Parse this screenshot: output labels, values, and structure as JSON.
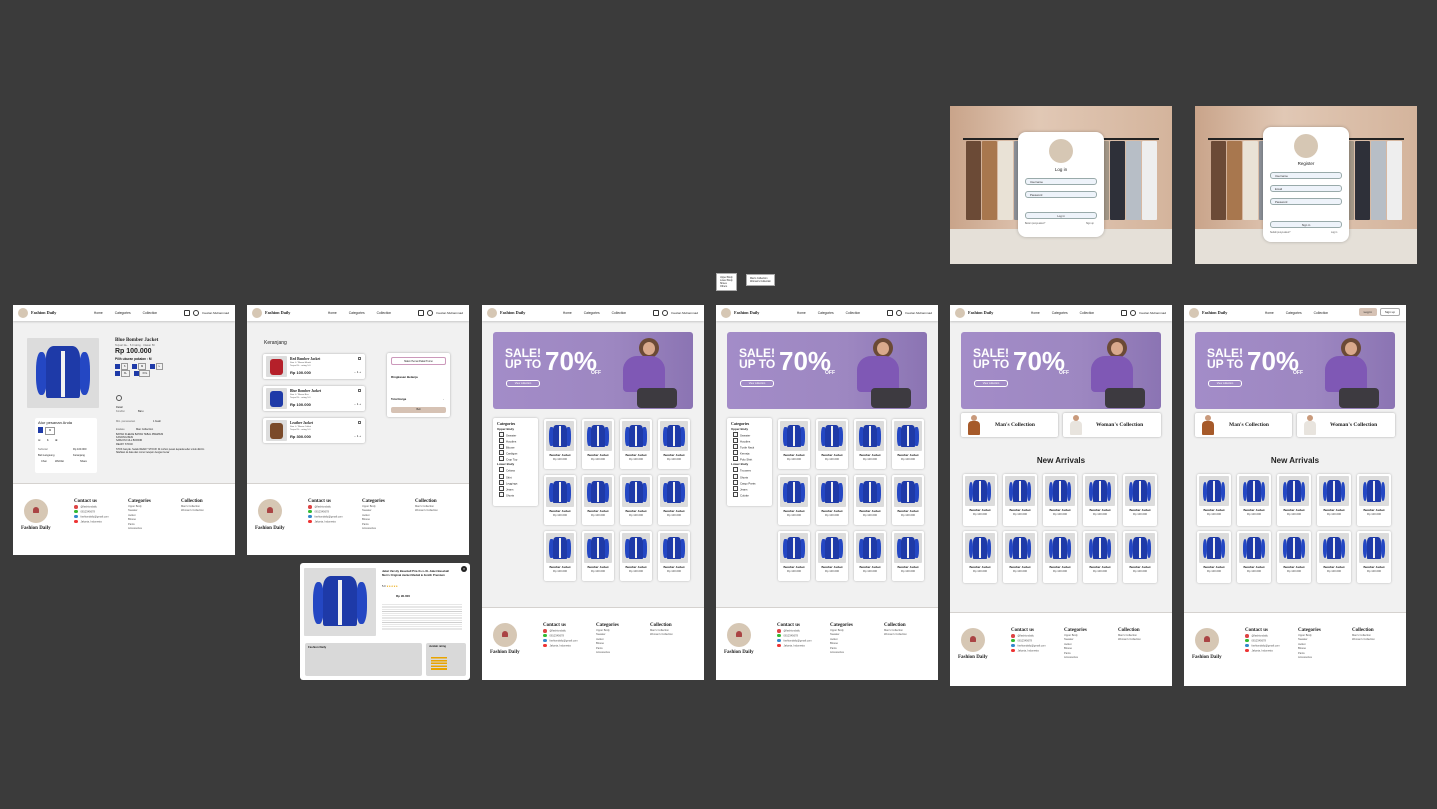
{
  "brand": "Fashion Daily",
  "nav": {
    "home": "Home",
    "categories": "Categories",
    "collection": "Collection",
    "user": "Fauzan Muhammad",
    "login": "Log in",
    "signup": "Sign up"
  },
  "banner": {
    "sale": "SALE!",
    "upto": "UP TO",
    "pct": "70%",
    "off": "OFF",
    "btn": "View collection"
  },
  "detail": {
    "title": "Blue Bomber Jacket",
    "sub": "Terjual 1k+ · 5.0 rating · Ulasan 50",
    "price": "Rp 100.000",
    "color_label": "Pilih ukuran pakaian : M",
    "sizes": [
      "S",
      "M",
      "L",
      "XL",
      "XXL"
    ],
    "order_title": "Atur pesanan Anda",
    "qty": "1",
    "subtotal_label": "Subtotal",
    "subtotal": "Rp 100.000",
    "buy": "Beli Langsung",
    "cart": "Keranjang",
    "chat": "Chat",
    "wishlist": "Wishlist",
    "share": "Share",
    "detail_tab": "Detail",
    "kondisi_label": "Kondisi",
    "kondisi": "Baru",
    "min_label": "Min. pemesanan",
    "min": "1 buah",
    "etalase_label": "Etalase",
    "etalase": "Man Collection",
    "desc1": "BAHAN FLEECE BAHAN TEBAL PREMIUM",
    "desc2": "KANCING BESI",
    "desc3": "SABLON FULL BORDIR",
    "desc4": "READY STOCK",
    "desc5": "STOK banyak. Selalu READY STOCK! Di mohon pesan kepada seller untuk dikirim",
    "desc6": "Silahkan isi data dan nomor telepon dengan benar"
  },
  "cart": {
    "title": "Keranjang",
    "items": [
      {
        "name": "Red Bomber Jacket",
        "d1": "Size L / Warna Merah",
        "d2": "Terjual 1k · rating 5.0",
        "price": "Rp 100.000",
        "qty": "1"
      },
      {
        "name": "Blue Bomber Jacket",
        "d1": "Size L / Warna Biru",
        "d2": "Terjual 1k · rating 5.0",
        "price": "Rp 100.000",
        "qty": "1"
      },
      {
        "name": "Leather Jacket",
        "d1": "Size L / Warna Coklat",
        "d2": "Terjual 1k · rating 5.0",
        "price": "Rp 300.000",
        "qty": "1"
      }
    ],
    "voucher": "Makin Hemat Pakai Promo",
    "summary": "Ringkasan Belanja",
    "total_label": "Total Harga",
    "total": "-",
    "buy": "Beli"
  },
  "popup": {
    "title": "Jaket Varsity Baseball Pria Xs-L-XL Jaket Baseball Men's Original Jacket Medali & Zenith Premium",
    "rating": "5.0",
    "price": "Rp 90.000",
    "store": "Fashion Daily",
    "rating_label": "Jumlah rating"
  },
  "categories": {
    "title": "Categories",
    "upper_title": "Upper Body",
    "upper": [
      "Sweater",
      "Hoodies",
      "Blouse",
      "Cardigan",
      "Crop Top"
    ],
    "upper_full": [
      "Sweater",
      "Hoodies",
      "Turtle Neck",
      "Kemeja",
      "Polo Shirt"
    ],
    "lower_title": "Lower Body",
    "lower": [
      "Celana",
      "Skirt",
      "Leggings",
      "Jeans",
      "Shorts"
    ],
    "lower_full": [
      "Trousers",
      "Shorts",
      "Cargo Pants",
      "Jeans",
      "Culotte"
    ]
  },
  "dropdown": {
    "a": [
      "Upper Body",
      "Lower Body",
      "Shoes",
      "Others"
    ],
    "b": [
      "Man's Collection",
      "Woman's Collection"
    ]
  },
  "products": [
    {
      "name": "Bomber Jacket",
      "price": "Rp 100.000"
    },
    {
      "name": "Bomber Jacket",
      "price": "Rp 100.000"
    },
    {
      "name": "Bomber Jacket",
      "price": "Rp 100.000"
    },
    {
      "name": "Bomber Jacket",
      "price": "Rp 100.000"
    },
    {
      "name": "Bomber Jacket",
      "price": "Rp 100.000"
    },
    {
      "name": "Bomber Jacket",
      "price": "Rp 100.000"
    },
    {
      "name": "Bomber Jacket",
      "price": "Rp 100.000"
    },
    {
      "name": "Bomber Jacket",
      "price": "Rp 100.000"
    },
    {
      "name": "Bomber Jacket",
      "price": "Rp 100.000"
    },
    {
      "name": "Bomber Jacket",
      "price": "Rp 100.000"
    },
    {
      "name": "Bomber Jacket",
      "price": "Rp 100.000"
    },
    {
      "name": "Bomber Jacket",
      "price": "Rp 100.000"
    }
  ],
  "collections": {
    "man": "Man's Collection",
    "woman": "Woman's Collection"
  },
  "new_arrivals": "New Arrivals",
  "footer": {
    "contact": "Contact us",
    "contacts": [
      "@fashiondaily",
      "0812345678",
      "fashiondaily@gmail.com",
      "Jakarta, Indonesia"
    ],
    "cat": "Categories",
    "cats": [
      "Upper Body",
      "Sweater",
      "Jacket",
      "Blouse",
      "Pants",
      "Accessories"
    ],
    "coll": "Collection",
    "colls": [
      "Man's Collection",
      "Woman's Collection"
    ]
  },
  "login": {
    "title": "Log in",
    "user": "Username",
    "pass": "Password",
    "btn": "Log in",
    "q": "Belum punya akun?",
    "link": "Sign up"
  },
  "register": {
    "title": "Register",
    "user": "Username",
    "email": "Email",
    "pass": "Password",
    "btn": "Sign in",
    "q": "Sudah punya akun?",
    "link": "Log in"
  }
}
